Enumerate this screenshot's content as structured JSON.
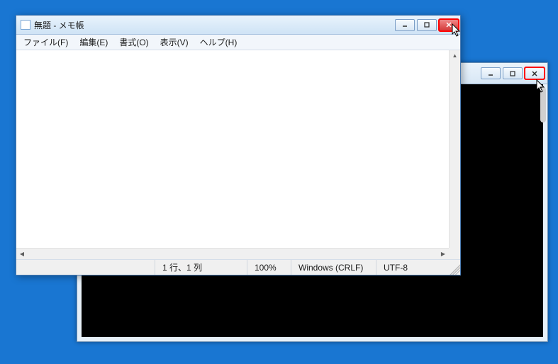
{
  "notepad": {
    "title": "無題 - メモ帳",
    "menu": {
      "file": "ファイル(F)",
      "edit": "編集(E)",
      "format": "書式(O)",
      "view": "表示(V)",
      "help": "ヘルプ(H)"
    },
    "status": {
      "position": "1 行、1 列",
      "zoom": "100%",
      "eol": "Windows (CRLF)",
      "encoding": "UTF-8"
    }
  }
}
